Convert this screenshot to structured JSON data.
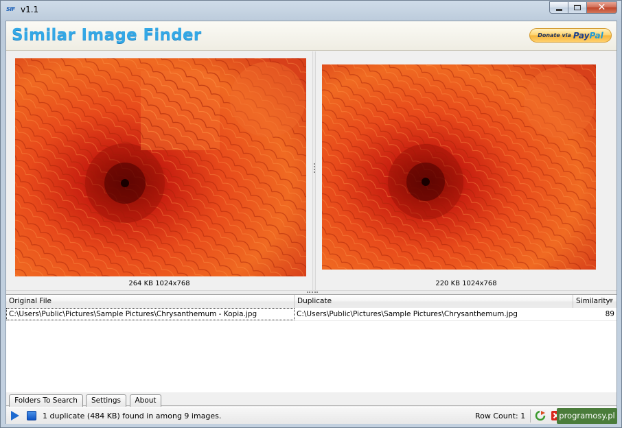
{
  "window": {
    "title": "v1.1",
    "icon_text": "SIF"
  },
  "header": {
    "app_name": "Similar Image Finder",
    "donate_label": "Donate via",
    "paypal_pay": "Pay",
    "paypal_pal": "Pal"
  },
  "left_image": {
    "caption": "264 KB 1024x768"
  },
  "right_image": {
    "caption": "220 KB 1024x768"
  },
  "results_grid": {
    "columns": [
      "Original File",
      "Duplicate",
      "Similarity"
    ],
    "rows": [
      {
        "original": "C:\\Users\\Public\\Pictures\\Sample Pictures\\Chrysanthemum - Kopia.jpg",
        "duplicate": "C:\\Users\\Public\\Pictures\\Sample Pictures\\Chrysanthemum.jpg",
        "similarity": "89"
      }
    ]
  },
  "tabs": [
    "Folders To Search",
    "Settings",
    "About"
  ],
  "status": {
    "message": "1 duplicate (484 KB) found in  among 9 images.",
    "row_count": "Row Count: 1"
  },
  "watermark": "programosy.pl",
  "colors": {
    "logo": "#33a8e6",
    "flower_orange": "#e8451b",
    "accent_blue": "#1d6ad0"
  }
}
